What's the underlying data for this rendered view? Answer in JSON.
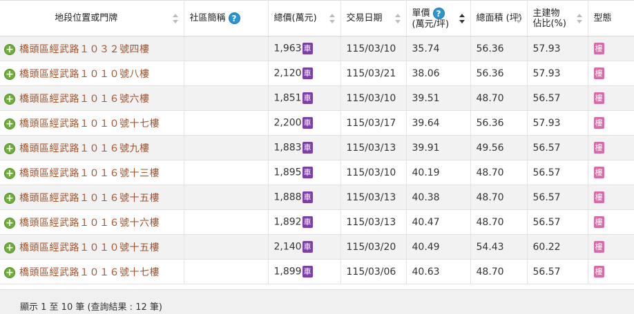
{
  "headers": {
    "address": "地段位置或門牌",
    "community": "社區簡稱",
    "total_price_line1": "總價(萬元)",
    "date": "交易日期",
    "unit_price_line1": "單價",
    "unit_price_line2": "(萬元/坪)",
    "area_line1": "總面積",
    "area_line2": "(坪)",
    "ratio_line1": "主建物",
    "ratio_line2": "佔比(%)",
    "type": "型態"
  },
  "help_symbol": "?",
  "expand_symbol": "+",
  "badge_car": "車",
  "badge_type": "樓",
  "rows": [
    {
      "address": "橋頭區經武路１０３２號四樓",
      "community": "",
      "total": "1,963",
      "date": "115/03/10",
      "unit": "35.74",
      "area": "56.36",
      "ratio": "57.93"
    },
    {
      "address": "橋頭區經武路１０１０號八樓",
      "community": "",
      "total": "2,120",
      "date": "115/03/21",
      "unit": "38.06",
      "area": "56.36",
      "ratio": "57.93"
    },
    {
      "address": "橋頭區經武路１０１６號六樓",
      "community": "",
      "total": "1,851",
      "date": "115/03/10",
      "unit": "39.51",
      "area": "48.70",
      "ratio": "56.57"
    },
    {
      "address": "橋頭區經武路１０１０號十七樓",
      "community": "",
      "total": "2,200",
      "date": "115/03/17",
      "unit": "39.64",
      "area": "56.36",
      "ratio": "57.93"
    },
    {
      "address": "橋頭區經武路１０１６號九樓",
      "community": "",
      "total": "1,883",
      "date": "115/03/13",
      "unit": "39.91",
      "area": "49.56",
      "ratio": "56.57"
    },
    {
      "address": "橋頭區經武路１０１６號十三樓",
      "community": "",
      "total": "1,895",
      "date": "115/03/10",
      "unit": "40.19",
      "area": "48.70",
      "ratio": "56.57"
    },
    {
      "address": "橋頭區經武路１０１６號十五樓",
      "community": "",
      "total": "1,888",
      "date": "115/03/13",
      "unit": "40.38",
      "area": "48.70",
      "ratio": "56.57"
    },
    {
      "address": "橋頭區經武路１０１６號十六樓",
      "community": "",
      "total": "1,892",
      "date": "115/03/13",
      "unit": "40.47",
      "area": "48.70",
      "ratio": "56.57"
    },
    {
      "address": "橋頭區經武路１０１０號十五樓",
      "community": "",
      "total": "2,140",
      "date": "115/03/20",
      "unit": "40.49",
      "area": "54.43",
      "ratio": "60.22"
    },
    {
      "address": "橋頭區經武路１０１６號十七樓",
      "community": "",
      "total": "1,899",
      "date": "115/03/06",
      "unit": "40.63",
      "area": "48.70",
      "ratio": "56.57"
    }
  ],
  "footer": "顯示 1 至 10 筆 (查詢結果 : 12 筆)",
  "colors": {
    "address_link": "#a0522d",
    "row_alt": "#f2f2f2",
    "badge_car": "#7b3fa6",
    "badge_type": "#d96aa8",
    "help": "#2a95d3",
    "plus": "#6fae3c"
  }
}
